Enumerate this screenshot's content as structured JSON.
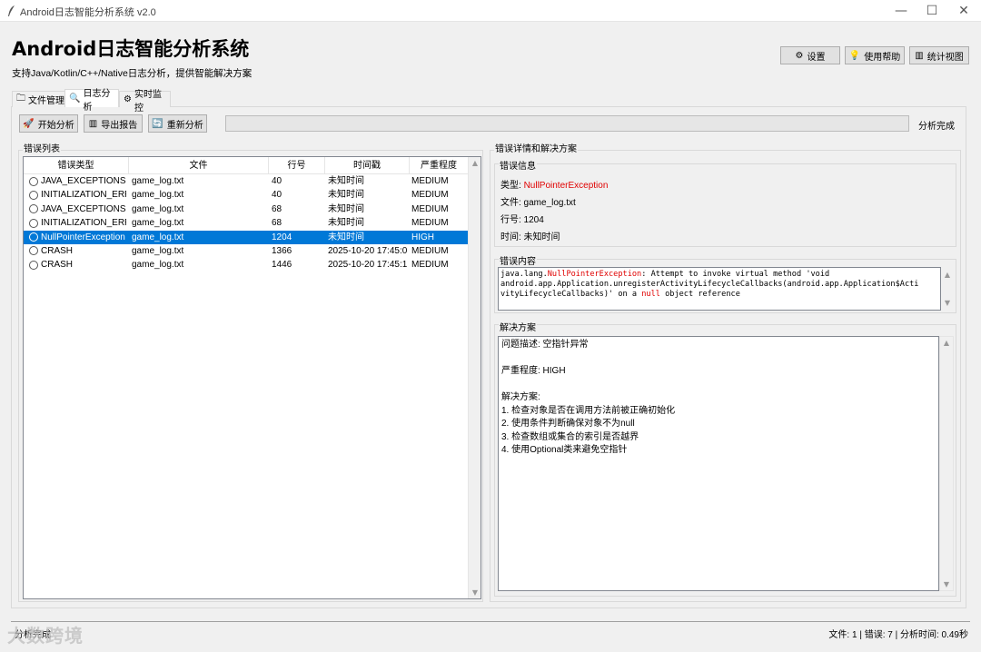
{
  "window": {
    "title": "Android日志智能分析系统 v2.0",
    "min_glyph": "—",
    "max_glyph": "☐",
    "close_glyph": "✕"
  },
  "header": {
    "title": "Android日志智能分析系统",
    "subtitle": "支持Java/Kotlin/C++/Native日志分析，提供智能解决方案",
    "buttons": [
      {
        "label": "设置",
        "icon": "gear-icon",
        "glyph": "⚙"
      },
      {
        "label": "使用帮助",
        "icon": "lightbulb-icon",
        "glyph": "💡"
      },
      {
        "label": "统计视图",
        "icon": "chart-icon",
        "glyph": "▥"
      }
    ]
  },
  "tabs": [
    {
      "label": "文件管理",
      "icon": "folder-icon",
      "glyph": "🗀"
    },
    {
      "label": "日志分析",
      "icon": "search-icon",
      "glyph": "🔍"
    },
    {
      "label": "实时监控",
      "icon": "monitor-icon",
      "glyph": "⚙"
    }
  ],
  "toolbar": {
    "start": {
      "label": "开始分析",
      "icon": "rocket-icon",
      "glyph": "🚀"
    },
    "export": {
      "label": "导出报告",
      "icon": "report-icon",
      "glyph": "▥"
    },
    "reanalyze": {
      "label": "重新分析",
      "icon": "refresh-icon",
      "glyph": "🔄"
    },
    "progress_fraction": 0,
    "status": "分析完成"
  },
  "error_list": {
    "label": "错误列表",
    "columns": [
      "错误类型",
      "文件",
      "行号",
      "时间戳",
      "严重程度"
    ],
    "rows": [
      {
        "type": "JAVA_EXCEPTIONS",
        "file": "game_log.txt",
        "line": "40",
        "time": "未知时间",
        "severity": "MEDIUM"
      },
      {
        "type": "INITIALIZATION_ERR",
        "file": "game_log.txt",
        "line": "40",
        "time": "未知时间",
        "severity": "MEDIUM"
      },
      {
        "type": "JAVA_EXCEPTIONS",
        "file": "game_log.txt",
        "line": "68",
        "time": "未知时间",
        "severity": "MEDIUM"
      },
      {
        "type": "INITIALIZATION_ERR",
        "file": "game_log.txt",
        "line": "68",
        "time": "未知时间",
        "severity": "MEDIUM"
      },
      {
        "type": "NullPointerException",
        "file": "game_log.txt",
        "line": "1204",
        "time": "未知时间",
        "severity": "HIGH"
      },
      {
        "type": "CRASH",
        "file": "game_log.txt",
        "line": "1366",
        "time": "2025-10-20 17:45:0",
        "severity": "MEDIUM"
      },
      {
        "type": "CRASH",
        "file": "game_log.txt",
        "line": "1446",
        "time": "2025-10-20 17:45:1",
        "severity": "MEDIUM"
      }
    ],
    "selected_index": 4
  },
  "details": {
    "label": "错误详情和解决方案",
    "info": {
      "label": "错误信息",
      "type_label": "类型: ",
      "type_value": "NullPointerException",
      "file": "文件: game_log.txt",
      "line": "行号: 1204",
      "time": "时间: 未知时间"
    },
    "content": {
      "label": "错误内容",
      "seg1": "java.lang.",
      "seg2": "NullPointerException",
      "seg3": ": Attempt to invoke virtual method 'void",
      "line2": "android.app.Application.unregisterActivityLifecycleCallbacks(android.app.Application$Acti",
      "line3a": "vityLifecycleCallbacks)' on a ",
      "line3b": "null",
      "line3c": " object reference"
    },
    "solution": {
      "label": "解决方案",
      "lines": [
        "问题描述: 空指针异常",
        "",
        "严重程度: HIGH",
        "",
        "解决方案:",
        "1. 检查对象是否在调用方法前被正确初始化",
        "2. 使用条件判断确保对象不为null",
        "3. 检查数组或集合的索引是否越界",
        "4. 使用Optional类来避免空指针"
      ]
    }
  },
  "statusbar": {
    "left": "分析完成",
    "right": "文件: 1 | 错误: 7 | 分析时间: 0.49秒"
  },
  "watermark": "大数跨境",
  "colors": {
    "accent": "#0078d7",
    "error_red": "#e00000",
    "code_red": "#e00000"
  }
}
